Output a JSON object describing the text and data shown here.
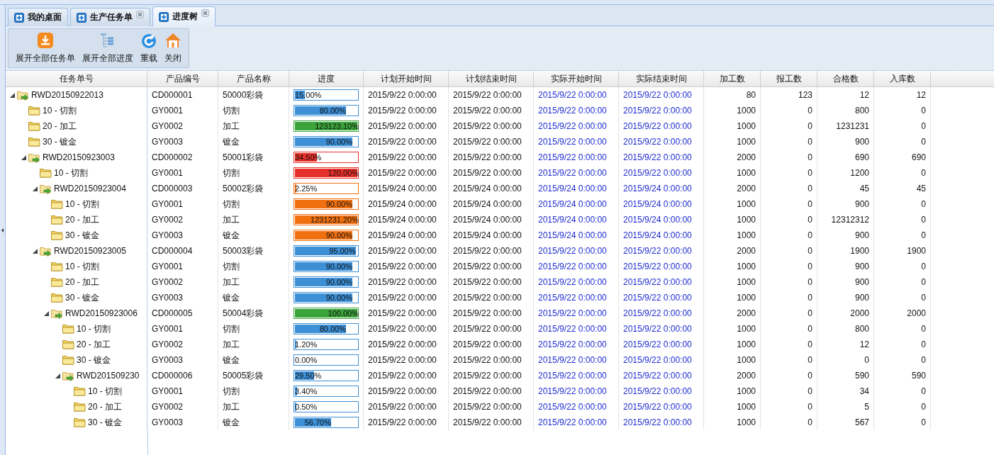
{
  "tabs": [
    {
      "label": "我的桌面",
      "selected": false,
      "closable": false
    },
    {
      "label": "生产任务单",
      "selected": false,
      "closable": true
    },
    {
      "label": "进度树",
      "selected": true,
      "closable": true
    }
  ],
  "toolbar": [
    {
      "label": "展开全部任务单",
      "kind": "download"
    },
    {
      "label": "展开全部进度",
      "kind": "tree"
    },
    {
      "label": "重载",
      "kind": "reload"
    },
    {
      "label": "关闭",
      "kind": "home"
    }
  ],
  "columns": [
    "任务单号",
    "产品编号",
    "产品名称",
    "进度",
    "计划开始时间",
    "计划结束时间",
    "实际开始时间",
    "实际结束时间",
    "加工数",
    "报工数",
    "合格数",
    "入库数"
  ],
  "tree": [
    {
      "kind": "task",
      "label": "RWD20150922013",
      "expanded": true,
      "code": "CD000001",
      "product": "50000彩袋",
      "progress": "15.00%",
      "level": 0.15,
      "color": "#3d8fd6",
      "plan_start": "2015/9/22 0:00:00",
      "plan_end": "2015/9/22 0:00:00",
      "actual_start": "2015/9/22 0:00:00",
      "actual_end": "2015/9/22 0:00:00",
      "processed": "80",
      "reported": "123",
      "qualified": "12",
      "stored": "12",
      "children": [
        {
          "kind": "step",
          "label": "10 - 切割",
          "code": "GY0001",
          "product": "切割",
          "progress": "80.00%",
          "level": 0.8,
          "color": "#3d8fd6",
          "plan_start": "2015/9/22 0:00:00",
          "plan_end": "2015/9/22 0:00:00",
          "actual_start": "2015/9/22 0:00:00",
          "actual_end": "2015/9/22 0:00:00",
          "processed": "1000",
          "reported": "0",
          "qualified": "800",
          "stored": "0"
        },
        {
          "kind": "step",
          "label": "20 - 加工",
          "code": "GY0002",
          "product": "加工",
          "progress": "123123.10%",
          "level": 1,
          "color": "#3aa33a",
          "plan_start": "2015/9/22 0:00:00",
          "plan_end": "2015/9/22 0:00:00",
          "actual_start": "2015/9/22 0:00:00",
          "actual_end": "2015/9/22 0:00:00",
          "processed": "1000",
          "reported": "0",
          "qualified": "1231231",
          "stored": "0"
        },
        {
          "kind": "step",
          "label": "30 - 镀金",
          "code": "GY0003",
          "product": "镀金",
          "progress": "90.00%",
          "level": 0.9,
          "color": "#3d8fd6",
          "plan_start": "2015/9/22 0:00:00",
          "plan_end": "2015/9/22 0:00:00",
          "actual_start": "2015/9/22 0:00:00",
          "actual_end": "2015/9/22 0:00:00",
          "processed": "1000",
          "reported": "0",
          "qualified": "900",
          "stored": "0"
        },
        {
          "kind": "task",
          "label": "RWD20150923003",
          "expanded": true,
          "code": "CD000002",
          "product": "50001彩袋",
          "progress": "34.50%",
          "level": 0.345,
          "color": "#e8302a",
          "plan_start": "2015/9/22 0:00:00",
          "plan_end": "2015/9/22 0:00:00",
          "actual_start": "2015/9/22 0:00:00",
          "actual_end": "2015/9/22 0:00:00",
          "processed": "2000",
          "reported": "0",
          "qualified": "690",
          "stored": "690",
          "children": [
            {
              "kind": "step",
              "label": "10 - 切割",
              "code": "GY0001",
              "product": "切割",
              "progress": "120.00%",
              "level": 1,
              "color": "#e8302a",
              "plan_start": "2015/9/22 0:00:00",
              "plan_end": "2015/9/22 0:00:00",
              "actual_start": "2015/9/22 0:00:00",
              "actual_end": "2015/9/22 0:00:00",
              "processed": "1000",
              "reported": "0",
              "qualified": "1200",
              "stored": "0"
            },
            {
              "kind": "task",
              "label": "RWD20150923004",
              "expanded": true,
              "code": "CD000003",
              "product": "50002彩袋",
              "progress": "2.25%",
              "level": 0.0225,
              "color": "#f07010",
              "plan_start": "2015/9/24 0:00:00",
              "plan_end": "2015/9/24 0:00:00",
              "actual_start": "2015/9/24 0:00:00",
              "actual_end": "2015/9/24 0:00:00",
              "processed": "2000",
              "reported": "0",
              "qualified": "45",
              "stored": "45",
              "children": [
                {
                  "kind": "step",
                  "label": "10 - 切割",
                  "code": "GY0001",
                  "product": "切割",
                  "progress": "90.00%",
                  "level": 0.9,
                  "color": "#f07010",
                  "plan_start": "2015/9/24 0:00:00",
                  "plan_end": "2015/9/24 0:00:00",
                  "actual_start": "2015/9/24 0:00:00",
                  "actual_end": "2015/9/24 0:00:00",
                  "processed": "1000",
                  "reported": "0",
                  "qualified": "900",
                  "stored": "0"
                },
                {
                  "kind": "step",
                  "label": "20 - 加工",
                  "code": "GY0002",
                  "product": "加工",
                  "progress": "1231231.20%",
                  "level": 1,
                  "color": "#f07010",
                  "plan_start": "2015/9/24 0:00:00",
                  "plan_end": "2015/9/24 0:00:00",
                  "actual_start": "2015/9/24 0:00:00",
                  "actual_end": "2015/9/24 0:00:00",
                  "processed": "1000",
                  "reported": "0",
                  "qualified": "12312312",
                  "stored": "0"
                },
                {
                  "kind": "step",
                  "label": "30 - 镀金",
                  "code": "GY0003",
                  "product": "镀金",
                  "progress": "90.00%",
                  "level": 0.9,
                  "color": "#f07010",
                  "plan_start": "2015/9/24 0:00:00",
                  "plan_end": "2015/9/24 0:00:00",
                  "actual_start": "2015/9/24 0:00:00",
                  "actual_end": "2015/9/24 0:00:00",
                  "processed": "1000",
                  "reported": "0",
                  "qualified": "900",
                  "stored": "0"
                }
              ]
            },
            {
              "kind": "task",
              "label": "RWD20150923005",
              "expanded": true,
              "code": "CD000004",
              "product": "50003彩袋",
              "progress": "95.00%",
              "level": 0.95,
              "color": "#3d8fd6",
              "plan_start": "2015/9/22 0:00:00",
              "plan_end": "2015/9/22 0:00:00",
              "actual_start": "2015/9/22 0:00:00",
              "actual_end": "2015/9/22 0:00:00",
              "processed": "2000",
              "reported": "0",
              "qualified": "1900",
              "stored": "1900",
              "children": [
                {
                  "kind": "step",
                  "label": "10 - 切割",
                  "code": "GY0001",
                  "product": "切割",
                  "progress": "90.00%",
                  "level": 0.9,
                  "color": "#3d8fd6",
                  "plan_start": "2015/9/22 0:00:00",
                  "plan_end": "2015/9/22 0:00:00",
                  "actual_start": "2015/9/22 0:00:00",
                  "actual_end": "2015/9/22 0:00:00",
                  "processed": "1000",
                  "reported": "0",
                  "qualified": "900",
                  "stored": "0"
                },
                {
                  "kind": "step",
                  "label": "20 - 加工",
                  "code": "GY0002",
                  "product": "加工",
                  "progress": "90.00%",
                  "level": 0.9,
                  "color": "#3d8fd6",
                  "plan_start": "2015/9/22 0:00:00",
                  "plan_end": "2015/9/22 0:00:00",
                  "actual_start": "2015/9/22 0:00:00",
                  "actual_end": "2015/9/22 0:00:00",
                  "processed": "1000",
                  "reported": "0",
                  "qualified": "900",
                  "stored": "0"
                },
                {
                  "kind": "step",
                  "label": "30 - 镀金",
                  "code": "GY0003",
                  "product": "镀金",
                  "progress": "90.00%",
                  "level": 0.9,
                  "color": "#3d8fd6",
                  "plan_start": "2015/9/22 0:00:00",
                  "plan_end": "2015/9/22 0:00:00",
                  "actual_start": "2015/9/22 0:00:00",
                  "actual_end": "2015/9/22 0:00:00",
                  "processed": "1000",
                  "reported": "0",
                  "qualified": "900",
                  "stored": "0"
                },
                {
                  "kind": "task",
                  "label": "RWD20150923006",
                  "expanded": true,
                  "code": "CD000005",
                  "product": "50004彩袋",
                  "progress": "100.00%",
                  "level": 1,
                  "color": "#3aa33a",
                  "plan_start": "2015/9/22 0:00:00",
                  "plan_end": "2015/9/22 0:00:00",
                  "actual_start": "2015/9/22 0:00:00",
                  "actual_end": "2015/9/22 0:00:00",
                  "processed": "2000",
                  "reported": "0",
                  "qualified": "2000",
                  "stored": "2000",
                  "children": [
                    {
                      "kind": "step",
                      "label": "10 - 切割",
                      "code": "GY0001",
                      "product": "切割",
                      "progress": "80.00%",
                      "level": 0.8,
                      "color": "#3d8fd6",
                      "plan_start": "2015/9/22 0:00:00",
                      "plan_end": "2015/9/22 0:00:00",
                      "actual_start": "2015/9/22 0:00:00",
                      "actual_end": "2015/9/22 0:00:00",
                      "processed": "1000",
                      "reported": "0",
                      "qualified": "800",
                      "stored": "0"
                    },
                    {
                      "kind": "step",
                      "label": "20 - 加工",
                      "code": "GY0002",
                      "product": "加工",
                      "progress": "1.20%",
                      "level": 0.012,
                      "color": "#3d8fd6",
                      "plan_start": "2015/9/22 0:00:00",
                      "plan_end": "2015/9/22 0:00:00",
                      "actual_start": "2015/9/22 0:00:00",
                      "actual_end": "2015/9/22 0:00:00",
                      "processed": "1000",
                      "reported": "0",
                      "qualified": "12",
                      "stored": "0"
                    },
                    {
                      "kind": "step",
                      "label": "30 - 镀金",
                      "code": "GY0003",
                      "product": "镀金",
                      "progress": "0.00%",
                      "level": 0,
                      "color": "#3d8fd6",
                      "plan_start": "2015/9/22 0:00:00",
                      "plan_end": "2015/9/22 0:00:00",
                      "actual_start": "2015/9/22 0:00:00",
                      "actual_end": "2015/9/22 0:00:00",
                      "processed": "1000",
                      "reported": "0",
                      "qualified": "0",
                      "stored": "0"
                    },
                    {
                      "kind": "task",
                      "label": "RWD201509230",
                      "expanded": true,
                      "code": "CD000006",
                      "product": "50005彩袋",
                      "progress": "29.50%",
                      "level": 0.295,
                      "color": "#3d8fd6",
                      "plan_start": "2015/9/22 0:00:00",
                      "plan_end": "2015/9/22 0:00:00",
                      "actual_start": "2015/9/22 0:00:00",
                      "actual_end": "2015/9/22 0:00:00",
                      "processed": "2000",
                      "reported": "0",
                      "qualified": "590",
                      "stored": "590",
                      "children": [
                        {
                          "kind": "step",
                          "label": "10 - 切割",
                          "code": "GY0001",
                          "product": "切割",
                          "progress": "3.40%",
                          "level": 0.034,
                          "color": "#3d8fd6",
                          "plan_start": "2015/9/22 0:00:00",
                          "plan_end": "2015/9/22 0:00:00",
                          "actual_start": "2015/9/22 0:00:00",
                          "actual_end": "2015/9/22 0:00:00",
                          "processed": "1000",
                          "reported": "0",
                          "qualified": "34",
                          "stored": "0"
                        },
                        {
                          "kind": "step",
                          "label": "20 - 加工",
                          "code": "GY0002",
                          "product": "加工",
                          "progress": "0.50%",
                          "level": 0.005,
                          "color": "#3d8fd6",
                          "plan_start": "2015/9/22 0:00:00",
                          "plan_end": "2015/9/22 0:00:00",
                          "actual_start": "2015/9/22 0:00:00",
                          "actual_end": "2015/9/22 0:00:00",
                          "processed": "1000",
                          "reported": "0",
                          "qualified": "5",
                          "stored": "0"
                        },
                        {
                          "kind": "step",
                          "label": "30 - 镀金",
                          "code": "GY0003",
                          "product": "镀金",
                          "progress": "56.70%",
                          "level": 0.567,
                          "color": "#3d8fd6",
                          "plan_start": "2015/9/22 0:00:00",
                          "plan_end": "2015/9/22 0:00:00",
                          "actual_start": "2015/9/22 0:00:00",
                          "actual_end": "2015/9/22 0:00:00",
                          "processed": "1000",
                          "reported": "0",
                          "qualified": "567",
                          "stored": "0"
                        }
                      ]
                    }
                  ]
                }
              ]
            }
          ]
        }
      ]
    }
  ]
}
